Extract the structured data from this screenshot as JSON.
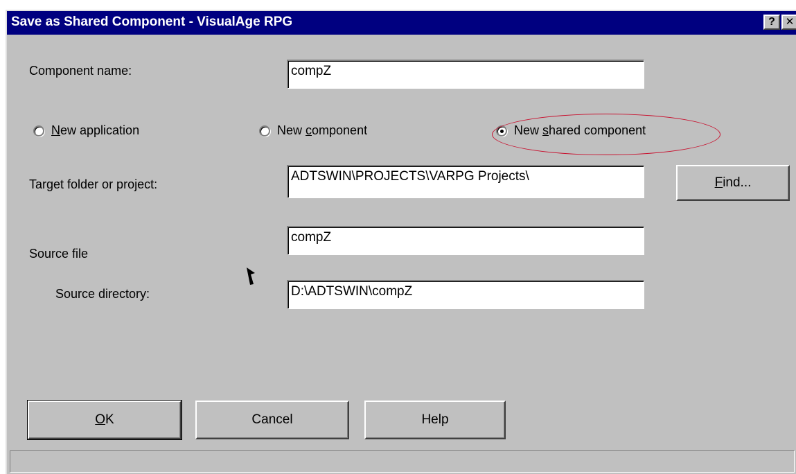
{
  "window": {
    "title": "Save as Shared Component - VisualAge RPG",
    "help_button": "?",
    "close_button": "✕"
  },
  "fields": {
    "component_name": {
      "label": "Component name:",
      "value": "compZ"
    },
    "target_folder": {
      "label": "Target folder or project:",
      "value": "ADTSWIN\\PROJECTS\\VARPG Projects\\"
    },
    "source_file": {
      "label": "Source file",
      "value": "compZ"
    },
    "source_directory": {
      "label": "Source directory:",
      "value": "D:\\ADTSWIN\\compZ"
    }
  },
  "radios": [
    {
      "label_pre": "",
      "accel": "N",
      "label_post": "ew application",
      "selected": false
    },
    {
      "label_pre": "New ",
      "accel": "c",
      "label_post": "omponent",
      "selected": false
    },
    {
      "label_pre": "New ",
      "accel": "s",
      "label_post": "hared component",
      "selected": true
    }
  ],
  "buttons": {
    "find": {
      "accel": "F",
      "rest": "ind..."
    },
    "ok": {
      "accel": "O",
      "rest": "K"
    },
    "cancel": "Cancel",
    "help": "Help"
  },
  "colors": {
    "title_bar": "#000080",
    "dialog_bg": "#c0c0c0",
    "highlight_ellipse": "#c8102e"
  }
}
